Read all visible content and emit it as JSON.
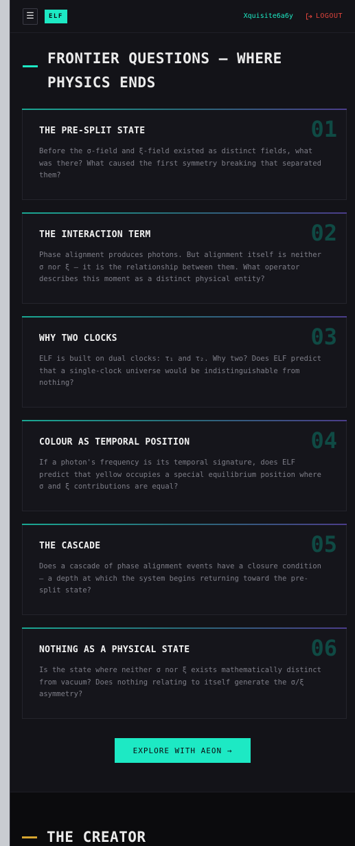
{
  "header": {
    "logo": "ELF",
    "username": "Xquisite6a6y",
    "logout_label": "LOGOUT",
    "menu_icon": "hamburger-icon",
    "logout_icon": "logout-arrow-icon"
  },
  "section": {
    "title_line1": "FRONTIER QUESTIONS — WHERE",
    "title_line2": "PHYSICS ENDS"
  },
  "cards": [
    {
      "num": "01",
      "title": "THE PRE-SPLIT STATE",
      "body": "Before the σ-field and ξ-field existed as distinct fields, what was there? What caused the first symmetry breaking that separated them?"
    },
    {
      "num": "02",
      "title": "THE INTERACTION TERM",
      "body": "Phase alignment produces photons. But alignment itself is neither σ nor ξ — it is the relationship between them. What operator describes this moment as a distinct physical entity?"
    },
    {
      "num": "03",
      "title": "WHY TWO CLOCKS",
      "body": "ELF is built on dual clocks: τ₁ and τ₂. Why two? Does ELF predict that a single-clock universe would be indistinguishable from nothing?"
    },
    {
      "num": "04",
      "title": "COLOUR AS TEMPORAL POSITION",
      "body": "If a photon's frequency is its temporal signature, does ELF predict that yellow occupies a special equilibrium position where σ and ξ contributions are equal?"
    },
    {
      "num": "05",
      "title": "THE CASCADE",
      "body": "Does a cascade of phase alignment events have a closure condition — a depth at which the system begins returning toward the pre-split state?"
    },
    {
      "num": "06",
      "title": "NOTHING AS A PHYSICAL STATE",
      "body": "Is the state where neither σ nor ξ exists mathematically distinct from vacuum? Does nothing relating to itself generate the σ/ξ asymmetry?"
    }
  ],
  "cta": {
    "label": "EXPLORE WITH AEON →"
  },
  "creator": {
    "title": "THE CREATOR"
  },
  "colors": {
    "accent": "#1de9c4",
    "danger": "#e0443c",
    "gold": "#d7a530",
    "bg": "#131318"
  }
}
